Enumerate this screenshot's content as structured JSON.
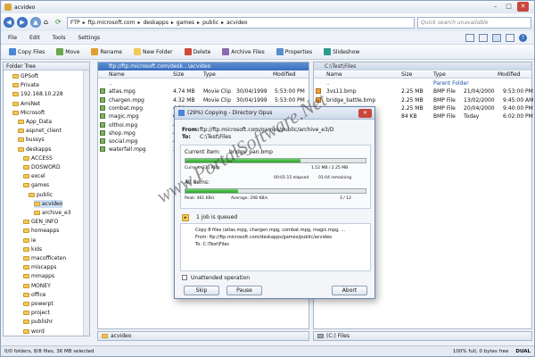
{
  "window": {
    "title": "acvideo"
  },
  "address": {
    "segments": [
      "FTP",
      "ftp.microsoft.com",
      "deskapps",
      "games",
      "public",
      "acvideo"
    ],
    "search_placeholder": "Quick search unavailable"
  },
  "menu": [
    "File",
    "Edit",
    "Tools",
    "Settings"
  ],
  "toolbar": [
    "Copy Files",
    "Move",
    "Rename",
    "New Folder",
    "Delete",
    "Archive Files",
    "Properties",
    "Slideshow"
  ],
  "tree": {
    "header": "Folder Tree",
    "items": [
      {
        "label": "GPSoft",
        "indent": 1
      },
      {
        "label": "Private",
        "indent": 1
      },
      {
        "label": "192.168.10.228",
        "indent": 1
      },
      {
        "label": "AmiNet",
        "indent": 1
      },
      {
        "label": "Microsoft",
        "indent": 1
      },
      {
        "label": "App_Data",
        "indent": 2
      },
      {
        "label": "aspnet_client",
        "indent": 2
      },
      {
        "label": "bussys",
        "indent": 2
      },
      {
        "label": "deskapps",
        "indent": 2
      },
      {
        "label": "ACCESS",
        "indent": 3
      },
      {
        "label": "DOSWORD",
        "indent": 3
      },
      {
        "label": "excel",
        "indent": 3
      },
      {
        "label": "games",
        "indent": 3
      },
      {
        "label": "public",
        "indent": 4
      },
      {
        "label": "acvideo",
        "indent": 5,
        "selected": true
      },
      {
        "label": "archive_e3",
        "indent": 5
      },
      {
        "label": "GEN_INFO",
        "indent": 3
      },
      {
        "label": "homeapps",
        "indent": 3
      },
      {
        "label": "ie",
        "indent": 3
      },
      {
        "label": "kids",
        "indent": 3
      },
      {
        "label": "macofficeten",
        "indent": 3
      },
      {
        "label": "miscapps",
        "indent": 3
      },
      {
        "label": "mmapps",
        "indent": 3
      },
      {
        "label": "MONEY",
        "indent": 3
      },
      {
        "label": "office",
        "indent": 3
      },
      {
        "label": "powerpt",
        "indent": 3
      },
      {
        "label": "project",
        "indent": 3
      },
      {
        "label": "publishr",
        "indent": 3
      },
      {
        "label": "word",
        "indent": 3
      }
    ]
  },
  "left_pane": {
    "path": "ftp://ftp.microsoft.com/desk...\\acvideo",
    "columns": [
      "Name",
      "Size",
      "Type",
      "Modified"
    ],
    "rows": [
      {
        "name": "..",
        "size": "",
        "type": "",
        "modified": "",
        "parent": true
      },
      {
        "name": "atlas.mpg",
        "size": "4.74 MB",
        "type": "Movie Clip",
        "modified": "30/04/1999",
        "time": "5:53:00 PM"
      },
      {
        "name": "chargen.mpg",
        "size": "4.32 MB",
        "type": "Movie Clip",
        "modified": "30/04/1999",
        "time": "5:53:00 PM"
      },
      {
        "name": "combat.mpg",
        "size": "4.34",
        "type": "",
        "modified": "",
        "time": ""
      },
      {
        "name": "magic.mpg",
        "size": "6.36",
        "type": "",
        "modified": "",
        "time": ""
      },
      {
        "name": "olthoi.mpg",
        "size": "4.02",
        "type": "",
        "modified": "",
        "time": ""
      },
      {
        "name": "shop.mpg",
        "size": "4.21",
        "type": "",
        "modified": "",
        "time": ""
      },
      {
        "name": "social.mpg",
        "size": "4.13",
        "type": "",
        "modified": "",
        "time": ""
      },
      {
        "name": "waterfall.mpg",
        "size": "3.01",
        "type": "",
        "modified": "",
        "time": ""
      }
    ],
    "footer_tab": "acvideo"
  },
  "right_pane": {
    "path": "C:\\Test\\Files",
    "columns": [
      "Name",
      "Size",
      "Type",
      "Modified"
    ],
    "rows": [
      {
        "name": "..",
        "size": "",
        "type": "Parent Folder",
        "modified": "",
        "parent": true
      },
      {
        "name": "3vs11.bmp",
        "size": "2.25 MB",
        "type": "BMP File",
        "modified": "21/04/2000",
        "time": "9:53:00 PM"
      },
      {
        "name": "bridge_battle.bmp",
        "size": "2.25 MB",
        "type": "BMP File",
        "modified": "13/02/2000",
        "time": "9:45:00 AM"
      },
      {
        "name": "",
        "size": "2.25 MB",
        "type": "BMP File",
        "modified": "20/04/2000",
        "time": "9:40:00 PM"
      },
      {
        "name": "",
        "size": "84 KB",
        "type": "BMP File",
        "modified": "Today",
        "time": "6:02:00 PM"
      }
    ],
    "footer_tab": "(C:) Files"
  },
  "dialog": {
    "title": "(29%) Copying - Directory Opus",
    "from_label": "From:",
    "from_value": "ftp://ftp.microsoft.com/games/public/archive_e3/D",
    "to_label": "To:",
    "to_value": "C:\\Test\\Files",
    "current_label": "Current item:",
    "current_value": "bridge_pan.bmp",
    "current_progress": 0.64,
    "current_speed": "Current: 331 KB/s",
    "current_size": "1.52 MB  /  2.25 MB",
    "all_label": "All items:",
    "all_progress": 0.29,
    "all_speed": "Peak: 461 KB/s",
    "all_average": "Average: 298 KB/s",
    "all_elapsed": "00:01:15 elapsed",
    "all_remaining": "01:04 remaining",
    "all_count": "3  /  12",
    "queue_label": "1 job is queued",
    "queue_lines": [
      "Copy 8 files (atlas.mpg, chargen.mpg, combat.mpg, magic.mpg, ...",
      "From:  ftp://ftp.microsoft.com/deskapps/games/public/acvideo",
      "To:     C:\\Test\\Files"
    ],
    "unattended_label": "Unattended operation",
    "skip": "Skip",
    "pause": "Pause",
    "abort": "Abort"
  },
  "status": {
    "left": "0/0 folders, 8/8 files, 36 MB selected",
    "right": "100% full, 0 bytes free",
    "mode": "DUAL"
  },
  "watermark": "www.PortalSoftware.Net",
  "colors": {
    "accent": "#3a6fc0",
    "progress": "#27a424",
    "folder": "#f1c95a"
  }
}
